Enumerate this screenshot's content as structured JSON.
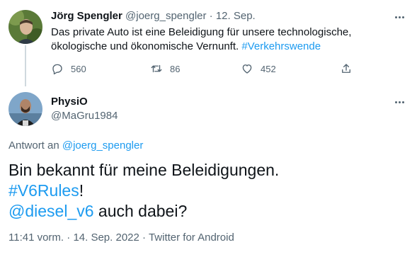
{
  "parent": {
    "display_name": "Jörg Spengler",
    "handle": "@joerg_spengler",
    "separator": "·",
    "date": "12. Sep.",
    "text": "Das private Auto ist eine Beleidigung für unsere technologische, ökologische und ökonomische Vernunft. ",
    "hashtag": "#Verkehrswende",
    "actions": {
      "replies": "560",
      "retweets": "86",
      "likes": "452"
    }
  },
  "tweet": {
    "display_name": "PhysiO",
    "handle": "@MaGru1984",
    "reply_prefix": "Antwort an ",
    "reply_handle": "@joerg_spengler",
    "line1": "Bin bekannt für meine Beleidigungen.",
    "hashtag": "#V6Rules",
    "hashtag_suffix": "!",
    "mention": "@diesel_v6",
    "line3_suffix": " auch dabei?",
    "time": "11:41 vorm.",
    "separator": "·",
    "date": "14. Sep. 2022",
    "source": "Twitter for Android"
  },
  "colors": {
    "accent": "#1d9bf0",
    "text": "#0f1419",
    "muted": "#536471",
    "thread_line": "#cfd9de"
  },
  "icons": [
    "reply-icon",
    "retweet-icon",
    "like-icon",
    "share-icon",
    "more-icon"
  ]
}
